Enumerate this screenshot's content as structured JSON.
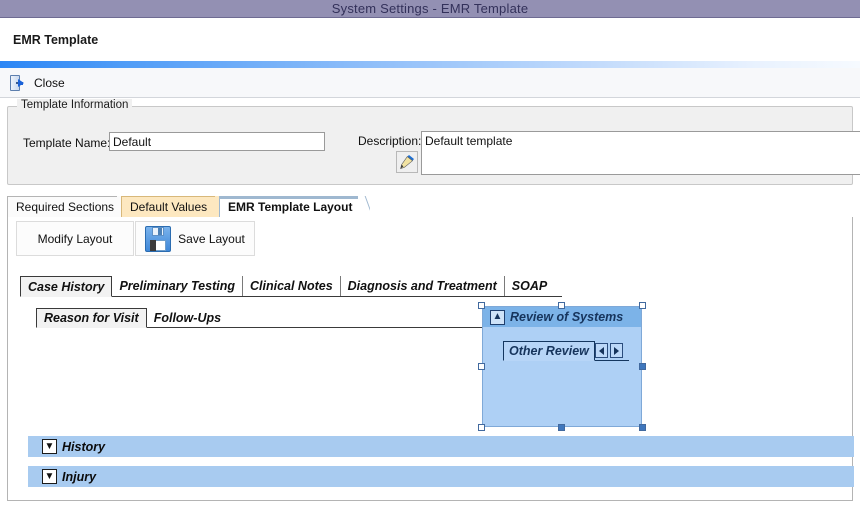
{
  "window": {
    "title": "System Settings - EMR Template",
    "title_bar_color": "#9390b3"
  },
  "page_header": {
    "title": "EMR Template"
  },
  "toolbar": {
    "close_label": "Close",
    "close_icon": "door-exit-icon"
  },
  "template_information": {
    "legend": "Template Information",
    "template_name_label": "Template Name:",
    "template_name_value": "Default",
    "description_label": "Description:",
    "description_value": "Default template",
    "description_edit_icon": "pencil-icon"
  },
  "outer_tabs": [
    {
      "label": "Required Sections",
      "active": false
    },
    {
      "label": "Default Values",
      "active": false
    },
    {
      "label": "EMR Template Layout",
      "active": true
    }
  ],
  "layout_toolbar": {
    "modify_label": "Modify Layout",
    "save_label": "Save Layout",
    "save_icon": "floppy-disk-icon"
  },
  "designer": {
    "inner_tabs": [
      {
        "label": "Case History",
        "active": true
      },
      {
        "label": "Preliminary Testing",
        "active": false
      },
      {
        "label": "Clinical Notes",
        "active": false
      },
      {
        "label": "Diagnosis and Treatment",
        "active": false
      },
      {
        "label": "SOAP",
        "active": false
      }
    ],
    "reason_tabs": [
      {
        "label": "Reason for Visit",
        "active": true
      },
      {
        "label": "Follow-Ups",
        "active": false
      }
    ],
    "selected_group": {
      "header_title": "Review of Systems",
      "collapse_icon": "chevron-up-double-icon",
      "header_color": "#7cb3e8",
      "body_color": "#aed0f5",
      "child_tab_label": "Other Review",
      "prev_icon": "triangle-left-icon",
      "next_icon": "triangle-right-icon"
    },
    "section_bars": [
      {
        "label": "History",
        "expand_icon": "chevron-down-double-icon",
        "glyph": "ˇ"
      },
      {
        "label": "Injury",
        "expand_icon": "chevron-down-double-icon",
        "glyph": "ˇ"
      }
    ],
    "section_bar_color": "#a8cbf0"
  }
}
